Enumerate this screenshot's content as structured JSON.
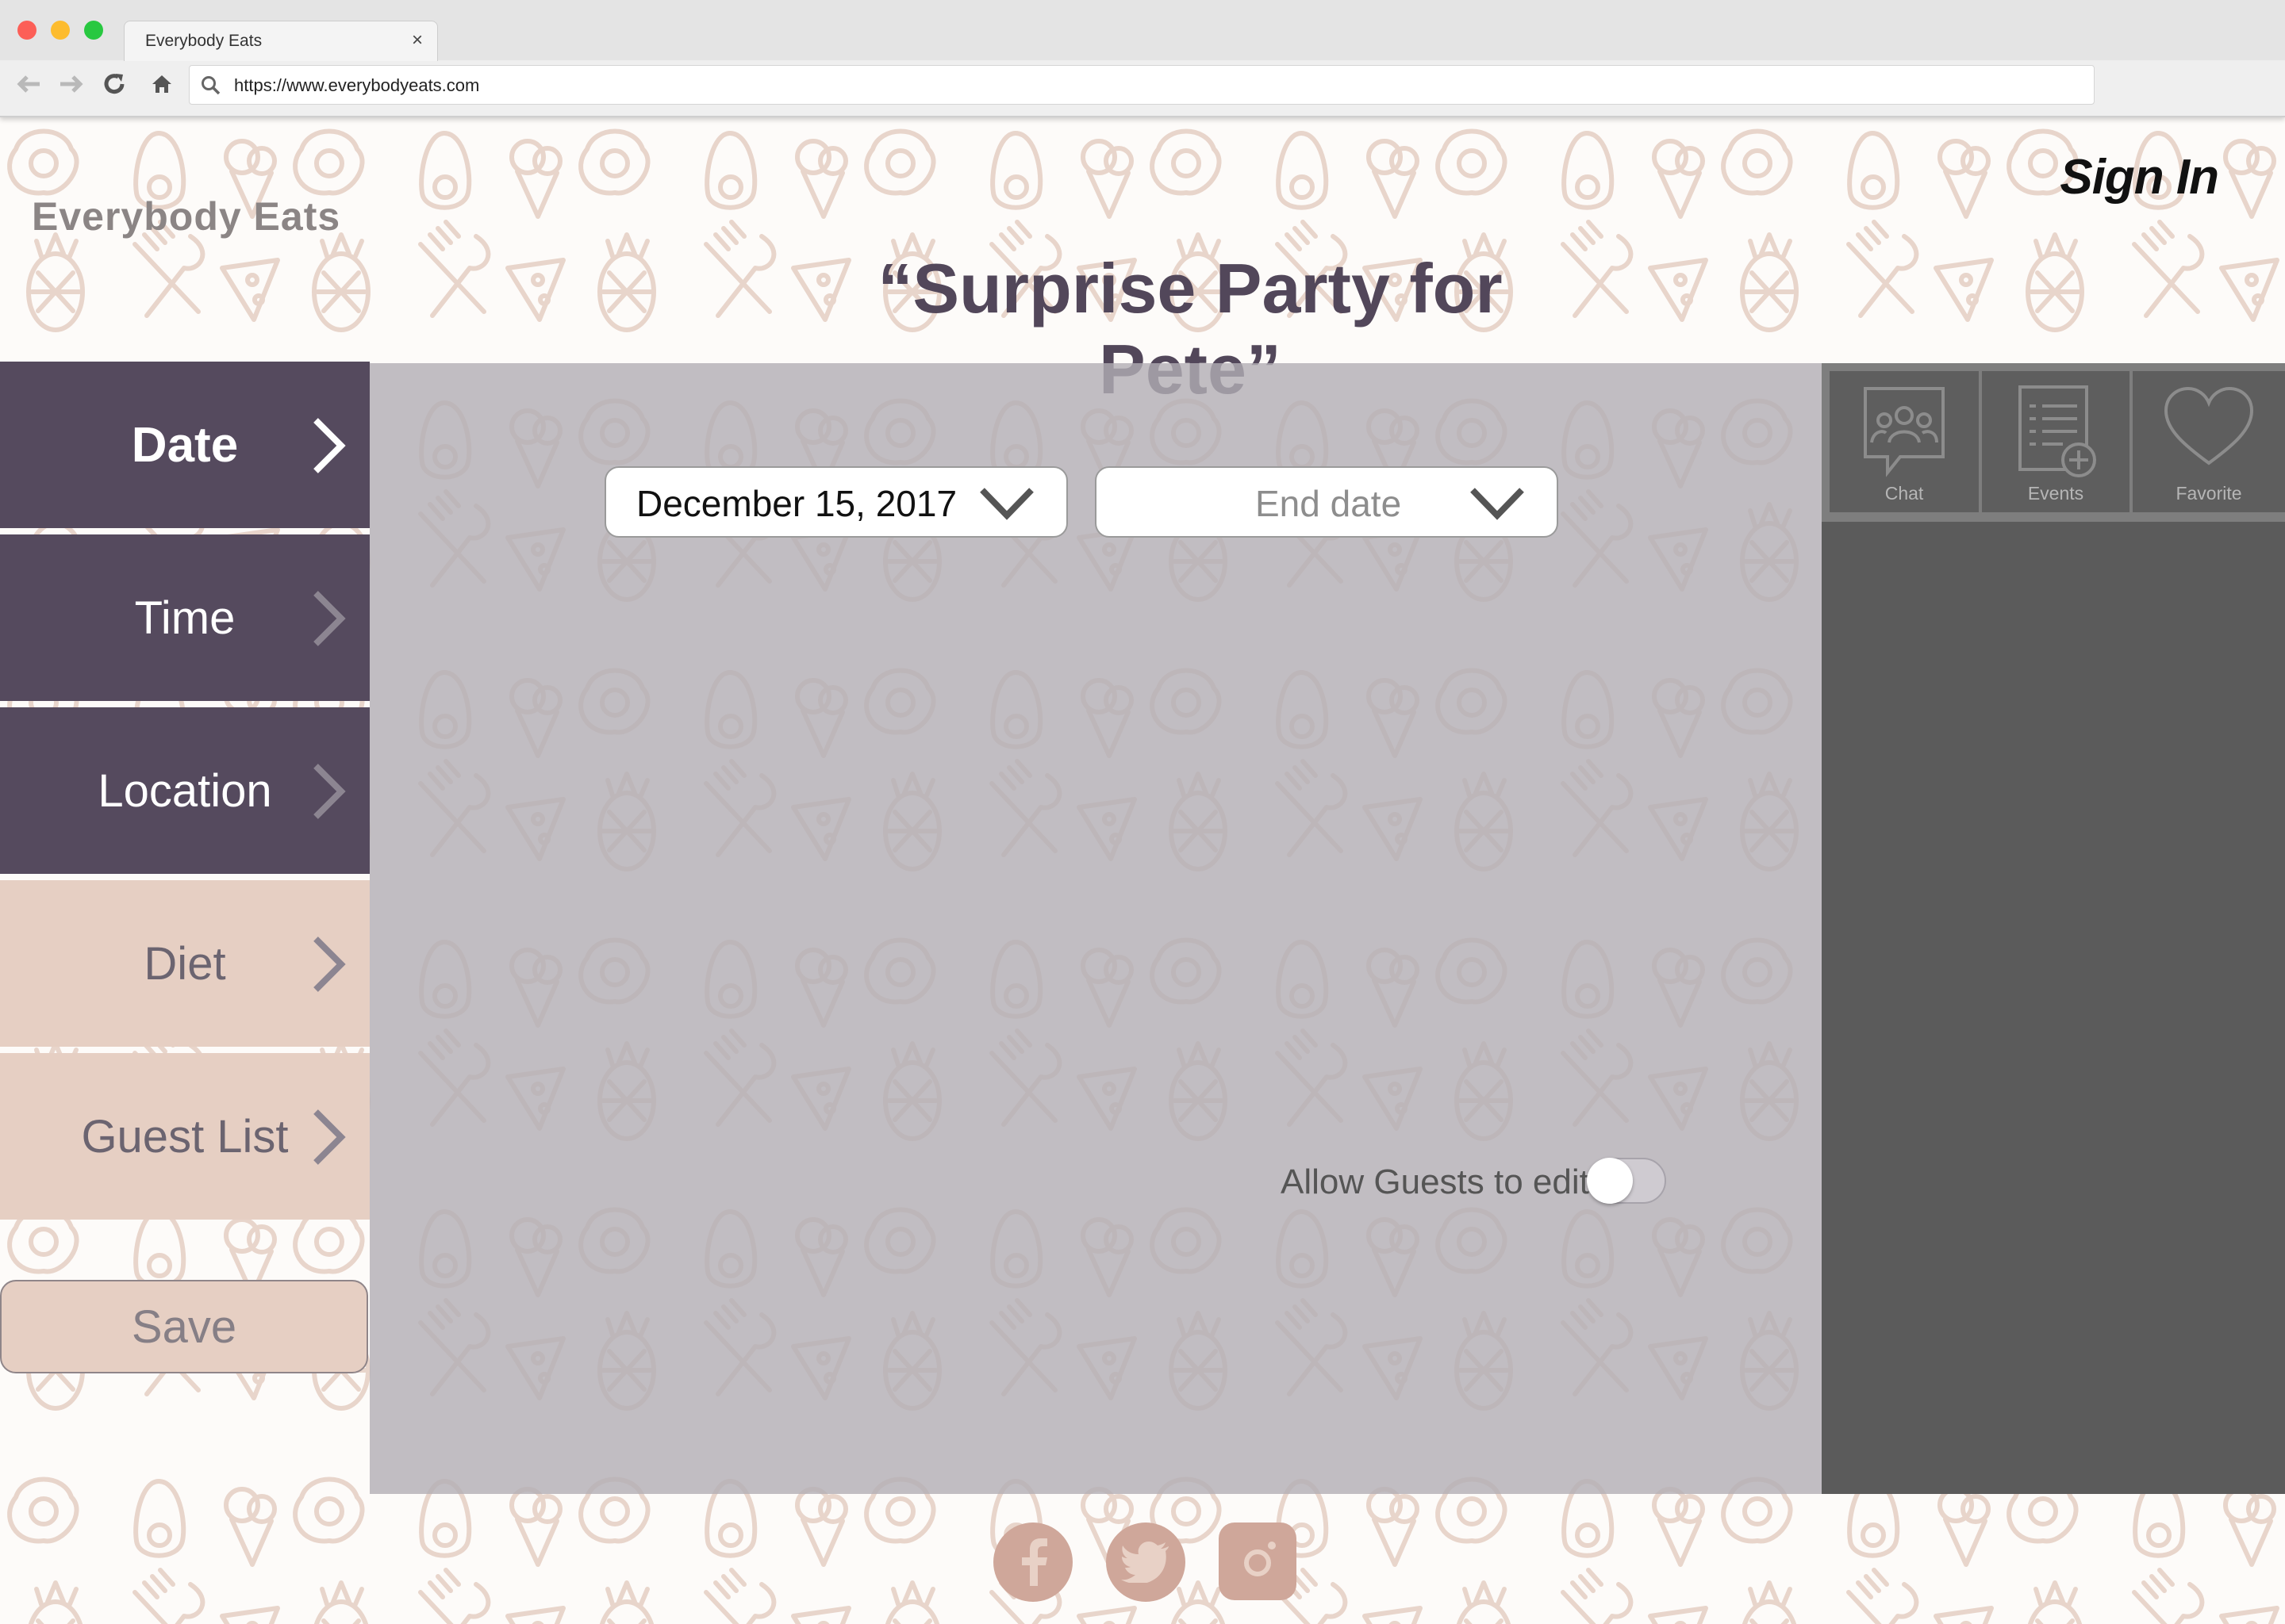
{
  "browser": {
    "tab_title": "Everybody Eats",
    "tab_close": "×",
    "url": "https://www.everybodyeats.com"
  },
  "header": {
    "brand": "Everybody Eats",
    "sign_in": "Sign In",
    "event_title": "“Surprise Party for Pete”"
  },
  "sidebar": {
    "items": [
      {
        "label": "Date",
        "state": "active"
      },
      {
        "label": "Time",
        "state": "dark"
      },
      {
        "label": "Location",
        "state": "dark"
      },
      {
        "label": "Diet",
        "state": "light"
      },
      {
        "label": "Guest List",
        "state": "light"
      }
    ],
    "save_label": "Save"
  },
  "main": {
    "start_date": "December 15, 2017",
    "end_date_placeholder": "End date",
    "allow_guests_label": "Allow Guests to edit",
    "allow_guests_on": false
  },
  "right_panel": {
    "icons": [
      {
        "label": "Chat",
        "icon": "chat-icon"
      },
      {
        "label": "Events",
        "icon": "events-icon"
      },
      {
        "label": "Favorite",
        "icon": "heart-icon"
      }
    ]
  },
  "social": {
    "icons": [
      "facebook-icon",
      "twitter-icon",
      "instagram-icon"
    ]
  },
  "colors": {
    "nav_dark": "#554a5e",
    "nav_light": "#e6cfc3",
    "title": "#52475a",
    "pattern": "#e8d5cb",
    "social": "#cfa79a"
  }
}
